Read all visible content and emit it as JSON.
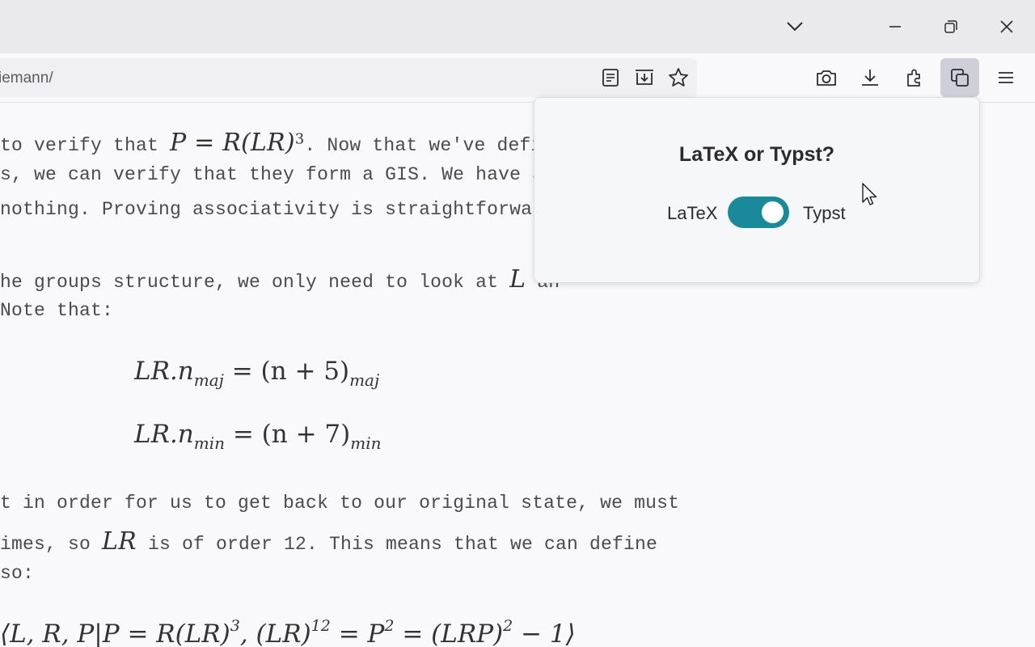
{
  "titlebar": {
    "buttons": [
      "list-all-tabs",
      "minimize",
      "restore",
      "close"
    ]
  },
  "navbar": {
    "url": "iemann/",
    "icons": [
      "reader-view-icon",
      "save-page-icon",
      "bookmark-star-icon",
      "screenshot-icon",
      "downloads-icon",
      "extensions-icon",
      "copy-extension-icon",
      "menu-icon"
    ]
  },
  "content": {
    "p1_l1_pre": "to verify that ",
    "p1_l1_math": "P = R(LR)",
    "p1_l1_sup": "3",
    "p1_l1_post": ". Now that we've defi",
    "p1_l2": "s, we can verify that they form a GIS. We have an",
    "p1_l3": " nothing. Proving associativity is straightforwar",
    "p2_l1_pre": "he groups structure, we only need to look at ",
    "p2_l1_math": "L",
    "p2_l1_post": " an",
    "p2_l2": " Note that:",
    "eq1_lhs": "LR.n",
    "eq1_sub1": "maj",
    "eq1_mid": " = (n + 5)",
    "eq1_sub2": "maj",
    "eq2_lhs": "LR.n",
    "eq2_sub1": "min",
    "eq2_mid": " = (n + 7)",
    "eq2_sub2": "min",
    "p3_l1": "t in order for us to get back to our original state, we must",
    "p3_l2_pre": "imes, so ",
    "p3_l2_math": "LR",
    "p3_l2_post": " is of order 12. This means that we can define",
    "p3_l3": " so:",
    "pres_a": "⟨L, R, P|P = R(LR)",
    "pres_sup1": "3",
    "pres_b": ", (LR)",
    "pres_sup2": "12",
    "pres_c": " = P",
    "pres_sup3": "2",
    "pres_d": " = (LRP)",
    "pres_sup4": "2",
    "pres_e": " − 1⟩"
  },
  "popup": {
    "title": "LaTeX or Typst?",
    "left_label": "LaTeX",
    "right_label": "Typst",
    "toggle_on": true,
    "accent": "#1a8a9a"
  }
}
